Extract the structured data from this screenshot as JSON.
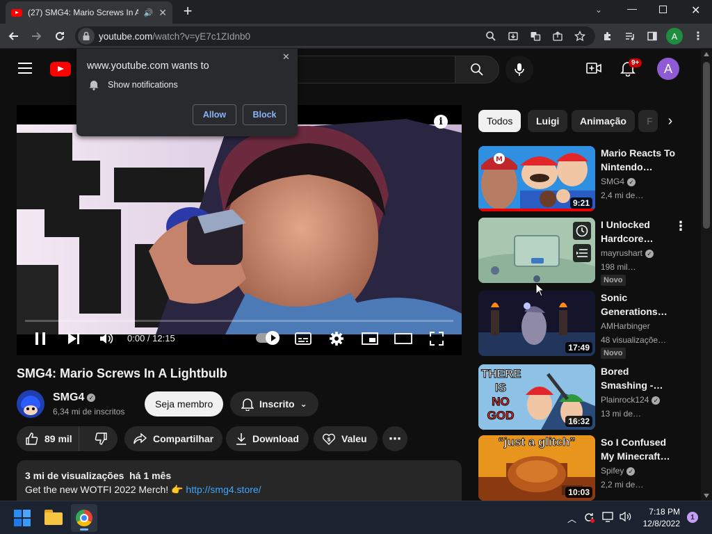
{
  "browser": {
    "tab_title": "(27) SMG4: Mario Screws In A",
    "url_host": "youtube.com",
    "url_path": "/watch?v=yE7c1ZIdnb0",
    "profile_letter": "A"
  },
  "notification_prompt": {
    "title": "www.youtube.com wants to",
    "permission": "Show notifications",
    "allow_label": "Allow",
    "block_label": "Block"
  },
  "youtube_header": {
    "notif_count": "9+",
    "avatar_letter": "A"
  },
  "player": {
    "time": "0:00 / 12:15",
    "progress": 0.0
  },
  "video": {
    "title": "SMG4: Mario Screws In A Lightbulb",
    "channel": "SMG4",
    "subscribers": "6,34 mi de inscritos",
    "join_label": "Seja membro",
    "subscribed_label": "Inscrito",
    "likes": "89 mil",
    "share_label": "Compartilhar",
    "download_label": "Download",
    "thanks_label": "Valeu",
    "views_date": "3 mi de visualizações  há 1 mês",
    "description": "Get the new WOTFI 2022 Merch! 👉",
    "description_link": "http://smg4.store/"
  },
  "chips": [
    "Todos",
    "Luigi",
    "Animação",
    "F"
  ],
  "recommendations": [
    {
      "title": "Mario Reacts To Nintendo…",
      "channel": "SMG4",
      "meta": "2,4 mi de…",
      "duration": "9:21",
      "new": ""
    },
    {
      "title": "I Unlocked Hardcore…",
      "channel": "mayrushart",
      "meta": "198 mil…",
      "duration": "",
      "new": "Novo"
    },
    {
      "title": "Sonic Generations…",
      "channel": "AMHarbinger",
      "meta": "48 visualizações…",
      "duration": "17:49",
      "new": "Novo"
    },
    {
      "title": "Bored Smashing -…",
      "channel": "Plainrock124",
      "meta": "13 mi de…",
      "duration": "16:32",
      "new": ""
    },
    {
      "title": "So I Confused My Minecraft…",
      "channel": "Spifey",
      "meta": "2,2 mi de…",
      "duration": "10:03",
      "new": ""
    }
  ],
  "thumb_text": {
    "there": "THERE",
    "is": "IS",
    "no": "NO",
    "god": "GOD",
    "glitch": "“just a glitch”"
  },
  "taskbar": {
    "time": "7:18 PM",
    "date": "12/8/2022",
    "notif_badge": "1"
  },
  "colors": {
    "accent_red": "#ff0000",
    "avatar_purple": "#8e5ad6",
    "link_blue": "#3ea6ff",
    "profile_green": "#1e8e3e"
  }
}
